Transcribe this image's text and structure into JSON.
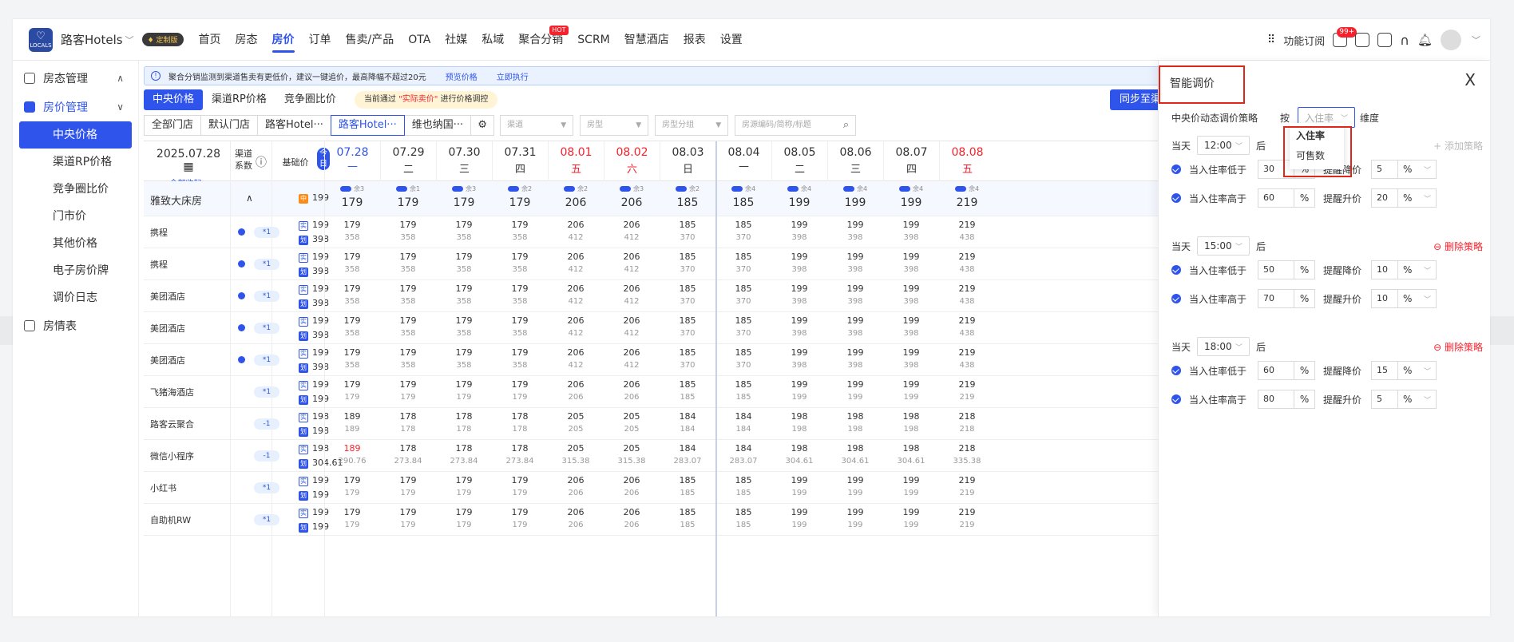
{
  "topbar": {
    "logo_text": "LOCALS",
    "brand": "路客Hotels",
    "badge": "定制版",
    "nav": [
      {
        "label": "首页"
      },
      {
        "label": "房态"
      },
      {
        "label": "房价",
        "active": true
      },
      {
        "label": "订单"
      },
      {
        "label": "售卖/产品"
      },
      {
        "label": "OTA"
      },
      {
        "label": "社媒"
      },
      {
        "label": "私域"
      },
      {
        "label": "聚合分销",
        "hot": "HOT"
      },
      {
        "label": "SCRM"
      },
      {
        "label": "智慧酒店"
      },
      {
        "label": "报表"
      },
      {
        "label": "设置"
      }
    ],
    "feature_subscribe": "功能订阅",
    "notif_count": "99+"
  },
  "sidebar": {
    "groups": [
      {
        "label": "房态管理",
        "arrow": "^"
      },
      {
        "label": "房价管理",
        "arrow": "v",
        "items": [
          "中央价格",
          "渠道RP价格",
          "竞争圈比价",
          "门市价",
          "其他价格",
          "电子房价牌",
          "调价日志"
        ]
      },
      {
        "label": "房情表"
      }
    ],
    "active_item": "中央价格"
  },
  "notice": {
    "text": "聚合分销监测到渠道售卖有更低价，建议一键追价，最高降幅不超过20元",
    "link1": "预览价格",
    "link2": "立即执行"
  },
  "tabs": [
    "中央价格",
    "渠道RP价格",
    "竞争圈比价"
  ],
  "tab_note_pre": "当前通过",
  "tab_note_hl": "\"实际卖价\"",
  "tab_note_post": "进行价格调控",
  "sync_button": "同步至渠道",
  "filters": {
    "stores": [
      "全部门店",
      "默认门店",
      "路客Hotel···",
      "路客Hotel···",
      "维也纳国···"
    ],
    "active_store_index": 3,
    "selects": [
      "渠道",
      "房型",
      "房型分组"
    ],
    "search_placeholder": "房源编码/简称/标题"
  },
  "grid": {
    "date_label": "2025.07.28",
    "collapse_all": "全部收起∧",
    "channel_coef": "渠道系数",
    "base_price": "基础价",
    "today": "今日",
    "dates": [
      {
        "d": "07.28",
        "w": "一",
        "today": true
      },
      {
        "d": "07.29",
        "w": "二"
      },
      {
        "d": "07.30",
        "w": "三"
      },
      {
        "d": "07.31",
        "w": "四"
      },
      {
        "d": "08.01",
        "w": "五",
        "red": true
      },
      {
        "d": "08.02",
        "w": "六",
        "red": true
      },
      {
        "d": "08.03",
        "w": "日"
      },
      {
        "d": "08.04",
        "w": "一"
      },
      {
        "d": "08.05",
        "w": "二"
      },
      {
        "d": "08.06",
        "w": "三"
      },
      {
        "d": "08.07",
        "w": "四"
      },
      {
        "d": "08.08",
        "w": "五",
        "red": true
      }
    ],
    "room": {
      "name": "雅致大床房",
      "base": "199",
      "base_tag": "中",
      "remain": [
        "余3",
        "余1",
        "余3",
        "余2",
        "余2",
        "余3",
        "余2",
        "余4",
        "余4",
        "余4",
        "余4",
        "余4"
      ],
      "prices": [
        "179",
        "179",
        "179",
        "179",
        "206",
        "206",
        "185",
        "185",
        "199",
        "199",
        "199",
        "219"
      ]
    },
    "rows": [
      {
        "name": "携程",
        "dot": true,
        "coef": "*1",
        "p1": "199",
        "p2": "398",
        "a": [
          "179",
          "179",
          "179",
          "179",
          "206",
          "206",
          "185",
          "185",
          "199",
          "199",
          "199",
          "219"
        ],
        "b": [
          "358",
          "358",
          "358",
          "358",
          "412",
          "412",
          "370",
          "370",
          "398",
          "398",
          "398",
          "438"
        ]
      },
      {
        "name": "携程",
        "dot": true,
        "coef": "*1",
        "p1": "199",
        "p2": "398",
        "a": [
          "179",
          "179",
          "179",
          "179",
          "206",
          "206",
          "185",
          "185",
          "199",
          "199",
          "199",
          "219"
        ],
        "b": [
          "358",
          "358",
          "358",
          "358",
          "412",
          "412",
          "370",
          "370",
          "398",
          "398",
          "398",
          "438"
        ]
      },
      {
        "name": "美团酒店",
        "dot": true,
        "coef": "*1",
        "p1": "199",
        "p2": "398",
        "a": [
          "179",
          "179",
          "179",
          "179",
          "206",
          "206",
          "185",
          "185",
          "199",
          "199",
          "199",
          "219"
        ],
        "b": [
          "358",
          "358",
          "358",
          "358",
          "412",
          "412",
          "370",
          "370",
          "398",
          "398",
          "398",
          "438"
        ]
      },
      {
        "name": "美团酒店",
        "dot": true,
        "coef": "*1",
        "p1": "199",
        "p2": "398",
        "a": [
          "179",
          "179",
          "179",
          "179",
          "206",
          "206",
          "185",
          "185",
          "199",
          "199",
          "199",
          "219"
        ],
        "b": [
          "358",
          "358",
          "358",
          "358",
          "412",
          "412",
          "370",
          "370",
          "398",
          "398",
          "398",
          "438"
        ]
      },
      {
        "name": "美团酒店",
        "dot": true,
        "coef": "*1",
        "p1": "199",
        "p2": "398",
        "a": [
          "179",
          "179",
          "179",
          "179",
          "206",
          "206",
          "185",
          "185",
          "199",
          "199",
          "199",
          "219"
        ],
        "b": [
          "358",
          "358",
          "358",
          "358",
          "412",
          "412",
          "370",
          "370",
          "398",
          "398",
          "398",
          "438"
        ]
      },
      {
        "name": "飞猪海酒店",
        "dot": false,
        "coef": "*1",
        "p1": "199",
        "p2": "199",
        "a": [
          "179",
          "179",
          "179",
          "179",
          "206",
          "206",
          "185",
          "185",
          "199",
          "199",
          "199",
          "219"
        ],
        "b": [
          "179",
          "179",
          "179",
          "179",
          "206",
          "206",
          "185",
          "185",
          "199",
          "199",
          "199",
          "219"
        ]
      },
      {
        "name": "路客云聚合",
        "dot": false,
        "coef": "-1",
        "p1": "198",
        "p2": "198",
        "a": [
          "189",
          "178",
          "178",
          "178",
          "205",
          "205",
          "184",
          "184",
          "198",
          "198",
          "198",
          "218"
        ],
        "b": [
          "189",
          "178",
          "178",
          "178",
          "205",
          "205",
          "184",
          "184",
          "198",
          "198",
          "198",
          "218"
        ]
      },
      {
        "name": "微信小程序",
        "dot": false,
        "coef": "-1",
        "p1": "198",
        "p2": "304.61",
        "a": [
          "189",
          "178",
          "178",
          "178",
          "205",
          "205",
          "184",
          "184",
          "198",
          "198",
          "198",
          "218"
        ],
        "b": [
          "290.76",
          "273.84",
          "273.84",
          "273.84",
          "315.38",
          "315.38",
          "283.07",
          "283.07",
          "304.61",
          "304.61",
          "304.61",
          "335.38"
        ],
        "first_red": true
      },
      {
        "name": "小红书",
        "dot": false,
        "coef": "*1",
        "p1": "199",
        "p2": "199",
        "a": [
          "179",
          "179",
          "179",
          "179",
          "206",
          "206",
          "185",
          "185",
          "199",
          "199",
          "199",
          "219"
        ],
        "b": [
          "179",
          "179",
          "179",
          "179",
          "206",
          "206",
          "185",
          "185",
          "199",
          "199",
          "199",
          "219"
        ]
      },
      {
        "name": "自助机RW",
        "dot": false,
        "coef": "*1",
        "p1": "199",
        "p2": "199",
        "a": [
          "179",
          "179",
          "179",
          "179",
          "206",
          "206",
          "185",
          "185",
          "199",
          "199",
          "199",
          "219"
        ],
        "b": [
          "179",
          "179",
          "179",
          "179",
          "206",
          "206",
          "185",
          "185",
          "199",
          "199",
          "199",
          "219"
        ]
      }
    ],
    "tag_actual": "实",
    "tag_list": "划"
  },
  "panel": {
    "title": "智能调价",
    "close": "X",
    "strategy_label": "中央价动态调价策略",
    "by": "按",
    "dimension_placeholder": "入住率",
    "dimension_suffix": "维度",
    "dropdown": [
      "入住率",
      "可售数"
    ],
    "today": "当天",
    "after": "后",
    "add_strategy": "+ 添加策略",
    "delete_strategy": "⊖ 删除策略",
    "pct": "%",
    "blocks": [
      {
        "time": "12:00",
        "action": "add",
        "rules": [
          {
            "label": "当入住率低于",
            "val": "30",
            "act": "提醒降价",
            "num": "5"
          },
          {
            "label": "当入住率高于",
            "val": "60",
            "act": "提醒升价",
            "num": "20"
          }
        ]
      },
      {
        "time": "15:00",
        "action": "del",
        "rules": [
          {
            "label": "当入住率低于",
            "val": "50",
            "act": "提醒降价",
            "num": "10"
          },
          {
            "label": "当入住率高于",
            "val": "70",
            "act": "提醒升价",
            "num": "10"
          }
        ]
      },
      {
        "time": "18:00",
        "action": "del",
        "rules": [
          {
            "label": "当入住率低于",
            "val": "60",
            "act": "提醒降价",
            "num": "15"
          },
          {
            "label": "当入住率高于",
            "val": "80",
            "act": "提醒升价",
            "num": "5"
          }
        ]
      }
    ]
  }
}
